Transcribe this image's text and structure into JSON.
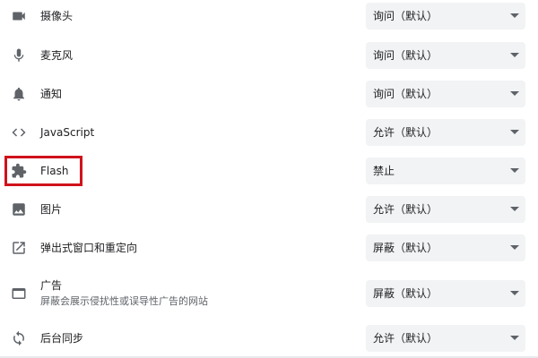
{
  "permissions": [
    {
      "key": "camera",
      "label": "摄像头",
      "value": "询问（默认）",
      "icon": "videocam-icon"
    },
    {
      "key": "microphone",
      "label": "麦克风",
      "value": "询问（默认）",
      "icon": "mic-icon"
    },
    {
      "key": "notifications",
      "label": "通知",
      "value": "询问（默认）",
      "icon": "bell-icon"
    },
    {
      "key": "javascript",
      "label": "JavaScript",
      "value": "允许（默认）",
      "icon": "code-icon"
    },
    {
      "key": "flash",
      "label": "Flash",
      "value": "禁止",
      "icon": "puzzle-icon"
    },
    {
      "key": "images",
      "label": "图片",
      "value": "允许（默认）",
      "icon": "image-icon"
    },
    {
      "key": "popups",
      "label": "弹出式窗口和重定向",
      "value": "屏蔽（默认）",
      "icon": "open-in-new-icon"
    },
    {
      "key": "ads",
      "label": "广告",
      "sublabel": "屏蔽会展示侵扰性或误导性广告的网站",
      "value": "屏蔽（默认）",
      "icon": "web-window-icon"
    },
    {
      "key": "background-sync",
      "label": "后台同步",
      "value": "允许（默认）",
      "icon": "sync-icon"
    }
  ],
  "colors": {
    "highlight": "#d0121b",
    "select_bg": "#f1f3f4",
    "icon": "#5f6368"
  }
}
